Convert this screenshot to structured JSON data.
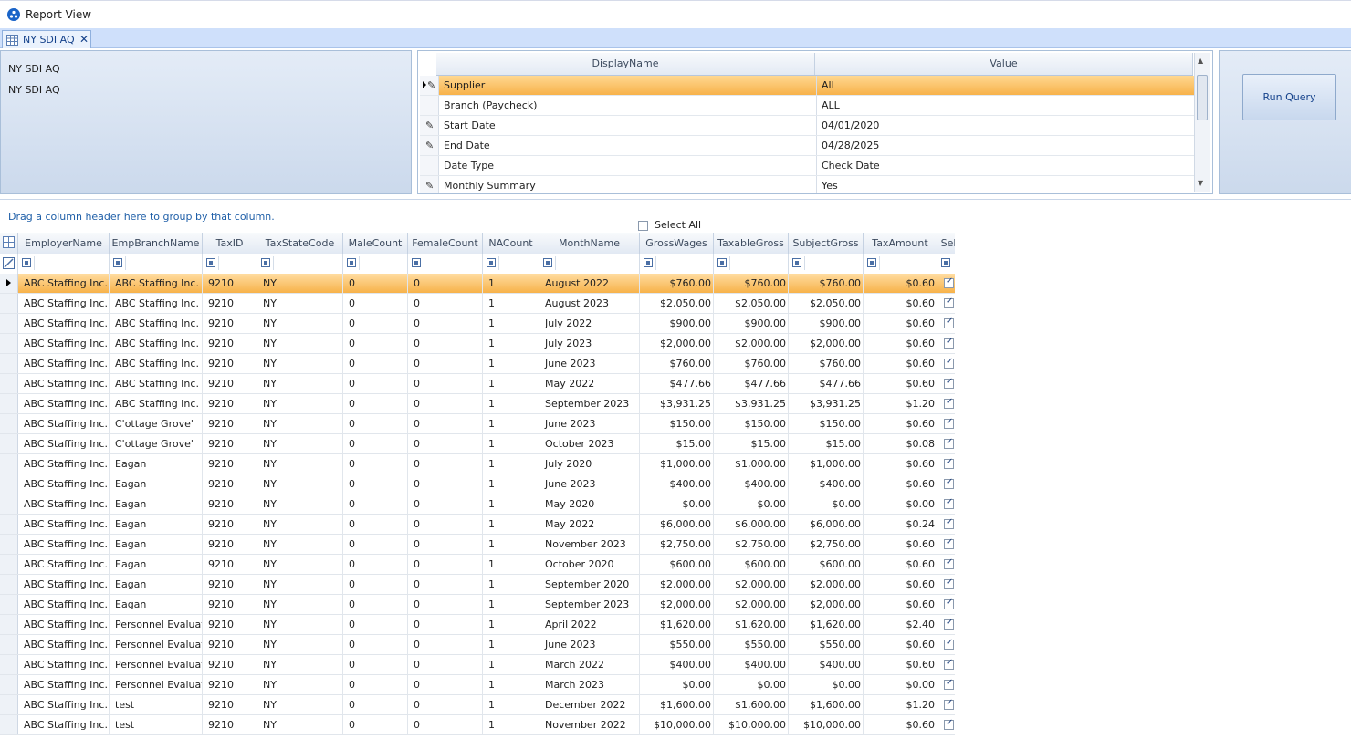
{
  "window": {
    "title": "Report View"
  },
  "tab": {
    "label": "NY SDI AQ",
    "close": "✕"
  },
  "left_panel": {
    "lines": [
      "NY SDI AQ",
      "NY SDI AQ"
    ]
  },
  "params": {
    "headers": {
      "name": "DisplayName",
      "value": "Value"
    },
    "rows": [
      {
        "name": "Supplier",
        "value": "All",
        "edit": true,
        "selected": true
      },
      {
        "name": "Branch (Paycheck)",
        "value": "ALL",
        "edit": false,
        "selected": false
      },
      {
        "name": "Start Date",
        "value": "04/01/2020",
        "edit": true,
        "selected": false
      },
      {
        "name": "End Date",
        "value": "04/28/2025",
        "edit": true,
        "selected": false
      },
      {
        "name": "Date Type",
        "value": "Check Date",
        "edit": false,
        "selected": false
      },
      {
        "name": "Monthly Summary",
        "value": "Yes",
        "edit": true,
        "selected": false
      }
    ]
  },
  "run_button": {
    "label": "Run Query"
  },
  "grid": {
    "group_hint": "Drag a column header here to group by that column.",
    "select_all_label": "Select All",
    "columns": [
      "EmployerName",
      "EmpBranchName",
      "TaxID",
      "TaxStateCode",
      "MaleCount",
      "FemaleCount",
      "NACount",
      "MonthName",
      "GrossWages",
      "TaxableGross",
      "SubjectGross",
      "TaxAmount",
      "Sel"
    ],
    "rows": [
      [
        "ABC Staffing Inc.",
        "ABC Staffing Inc.",
        "9210",
        "NY",
        "0",
        "0",
        "1",
        "August 2022",
        "$760.00",
        "$760.00",
        "$760.00",
        "$0.60"
      ],
      [
        "ABC Staffing Inc.",
        "ABC Staffing Inc.",
        "9210",
        "NY",
        "0",
        "0",
        "1",
        "August 2023",
        "$2,050.00",
        "$2,050.00",
        "$2,050.00",
        "$0.60"
      ],
      [
        "ABC Staffing Inc.",
        "ABC Staffing Inc.",
        "9210",
        "NY",
        "0",
        "0",
        "1",
        "July 2022",
        "$900.00",
        "$900.00",
        "$900.00",
        "$0.60"
      ],
      [
        "ABC Staffing Inc.",
        "ABC Staffing Inc.",
        "9210",
        "NY",
        "0",
        "0",
        "1",
        "July 2023",
        "$2,000.00",
        "$2,000.00",
        "$2,000.00",
        "$0.60"
      ],
      [
        "ABC Staffing Inc.",
        "ABC Staffing Inc.",
        "9210",
        "NY",
        "0",
        "0",
        "1",
        "June 2023",
        "$760.00",
        "$760.00",
        "$760.00",
        "$0.60"
      ],
      [
        "ABC Staffing Inc.",
        "ABC Staffing Inc.",
        "9210",
        "NY",
        "0",
        "0",
        "1",
        "May 2022",
        "$477.66",
        "$477.66",
        "$477.66",
        "$0.60"
      ],
      [
        "ABC Staffing Inc.",
        "ABC Staffing Inc.",
        "9210",
        "NY",
        "0",
        "0",
        "1",
        "September 2023",
        "$3,931.25",
        "$3,931.25",
        "$3,931.25",
        "$1.20"
      ],
      [
        "ABC Staffing Inc.",
        "C'ottage Grove'",
        "9210",
        "NY",
        "0",
        "0",
        "1",
        "June 2023",
        "$150.00",
        "$150.00",
        "$150.00",
        "$0.60"
      ],
      [
        "ABC Staffing Inc.",
        "C'ottage Grove'",
        "9210",
        "NY",
        "0",
        "0",
        "1",
        "October 2023",
        "$15.00",
        "$15.00",
        "$15.00",
        "$0.08"
      ],
      [
        "ABC Staffing Inc.",
        "Eagan",
        "9210",
        "NY",
        "0",
        "0",
        "1",
        "July 2020",
        "$1,000.00",
        "$1,000.00",
        "$1,000.00",
        "$0.60"
      ],
      [
        "ABC Staffing Inc.",
        "Eagan",
        "9210",
        "NY",
        "0",
        "0",
        "1",
        "June 2023",
        "$400.00",
        "$400.00",
        "$400.00",
        "$0.60"
      ],
      [
        "ABC Staffing Inc.",
        "Eagan",
        "9210",
        "NY",
        "0",
        "0",
        "1",
        "May 2020",
        "$0.00",
        "$0.00",
        "$0.00",
        "$0.00"
      ],
      [
        "ABC Staffing Inc.",
        "Eagan",
        "9210",
        "NY",
        "0",
        "0",
        "1",
        "May 2022",
        "$6,000.00",
        "$6,000.00",
        "$6,000.00",
        "$0.24"
      ],
      [
        "ABC Staffing Inc.",
        "Eagan",
        "9210",
        "NY",
        "0",
        "0",
        "1",
        "November 2023",
        "$2,750.00",
        "$2,750.00",
        "$2,750.00",
        "$0.60"
      ],
      [
        "ABC Staffing Inc.",
        "Eagan",
        "9210",
        "NY",
        "0",
        "0",
        "1",
        "October 2020",
        "$600.00",
        "$600.00",
        "$600.00",
        "$0.60"
      ],
      [
        "ABC Staffing Inc.",
        "Eagan",
        "9210",
        "NY",
        "0",
        "0",
        "1",
        "September 2020",
        "$2,000.00",
        "$2,000.00",
        "$2,000.00",
        "$0.60"
      ],
      [
        "ABC Staffing Inc.",
        "Eagan",
        "9210",
        "NY",
        "0",
        "0",
        "1",
        "September 2023",
        "$2,000.00",
        "$2,000.00",
        "$2,000.00",
        "$0.60"
      ],
      [
        "ABC Staffing Inc.",
        "Personnel Evaluati",
        "9210",
        "NY",
        "0",
        "0",
        "1",
        "April 2022",
        "$1,620.00",
        "$1,620.00",
        "$1,620.00",
        "$2.40"
      ],
      [
        "ABC Staffing Inc.",
        "Personnel Evaluati",
        "9210",
        "NY",
        "0",
        "0",
        "1",
        "June 2023",
        "$550.00",
        "$550.00",
        "$550.00",
        "$0.60"
      ],
      [
        "ABC Staffing Inc.",
        "Personnel Evaluati",
        "9210",
        "NY",
        "0",
        "0",
        "1",
        "March 2022",
        "$400.00",
        "$400.00",
        "$400.00",
        "$0.60"
      ],
      [
        "ABC Staffing Inc.",
        "Personnel Evaluati",
        "9210",
        "NY",
        "0",
        "0",
        "1",
        "March 2023",
        "$0.00",
        "$0.00",
        "$0.00",
        "$0.00"
      ],
      [
        "ABC Staffing Inc.",
        "test",
        "9210",
        "NY",
        "0",
        "0",
        "1",
        "December 2022",
        "$1,600.00",
        "$1,600.00",
        "$1,600.00",
        "$1.20"
      ],
      [
        "ABC Staffing Inc.",
        "test",
        "9210",
        "NY",
        "0",
        "0",
        "1",
        "November 2022",
        "$10,000.00",
        "$10,000.00",
        "$10,000.00",
        "$0.60"
      ]
    ],
    "selected_row": 0
  },
  "colors": {
    "selection": "#f7b24a",
    "accent": "#15428b",
    "hint": "#1f5fa8"
  }
}
